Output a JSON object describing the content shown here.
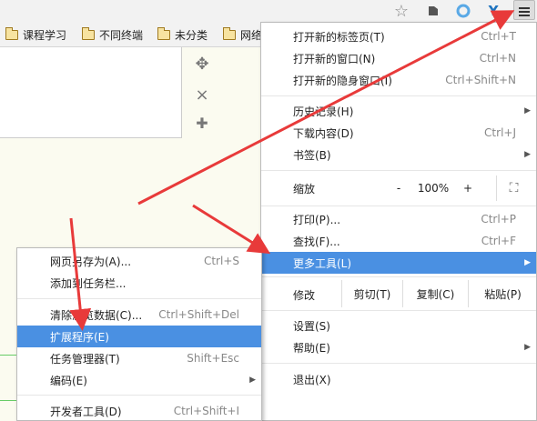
{
  "colors": {
    "highlight": "#4a90e2",
    "arrow": "#e83a3a"
  },
  "toolbar": {
    "icons": [
      "star-icon",
      "evernote-icon",
      "extension-ring-icon",
      "y-extension-icon",
      "menu-icon"
    ]
  },
  "bookmarks": [
    {
      "label": "课程学习"
    },
    {
      "label": "不同终端"
    },
    {
      "label": "未分类"
    },
    {
      "label": "网络"
    }
  ],
  "page": {
    "controls": [
      "move-icon",
      "close-icon",
      "add-icon"
    ],
    "move_glyph": "✥",
    "close_glyph": "×",
    "add_glyph": "✚"
  },
  "main_menu": {
    "new_tab": {
      "label": "打开新的标签页(T)",
      "shortcut": "Ctrl+T"
    },
    "new_window": {
      "label": "打开新的窗口(N)",
      "shortcut": "Ctrl+N"
    },
    "incognito": {
      "label": "打开新的隐身窗口(I)",
      "shortcut": "Ctrl+Shift+N"
    },
    "history": {
      "label": "历史记录(H)"
    },
    "downloads": {
      "label": "下载内容(D)",
      "shortcut": "Ctrl+J"
    },
    "bookmarks": {
      "label": "书签(B)"
    },
    "zoom": {
      "label": "缩放",
      "minus": "-",
      "value": "100%",
      "plus": "+",
      "fullscreen": "⛶"
    },
    "print": {
      "label": "打印(P)...",
      "shortcut": "Ctrl+P"
    },
    "find": {
      "label": "查找(F)...",
      "shortcut": "Ctrl+F"
    },
    "more_tools": {
      "label": "更多工具(L)"
    },
    "edit": {
      "label": "修改",
      "cut": "剪切(T)",
      "copy": "复制(C)",
      "paste": "粘贴(P)"
    },
    "settings": {
      "label": "设置(S)"
    },
    "help": {
      "label": "帮助(E)"
    },
    "exit": {
      "label": "退出(X)"
    }
  },
  "sub_menu": {
    "save_page": {
      "label": "网页另存为(A)...",
      "shortcut": "Ctrl+S"
    },
    "add_taskbar": {
      "label": "添加到任务栏..."
    },
    "clear_data": {
      "label": "清除浏览数据(C)...",
      "shortcut": "Ctrl+Shift+Del"
    },
    "extensions": {
      "label": "扩展程序(E)"
    },
    "task_manager": {
      "label": "任务管理器(T)",
      "shortcut": "Shift+Esc"
    },
    "encoding": {
      "label": "编码(E)"
    },
    "devtools": {
      "label": "开发者工具(D)",
      "shortcut": "Ctrl+Shift+I"
    }
  }
}
